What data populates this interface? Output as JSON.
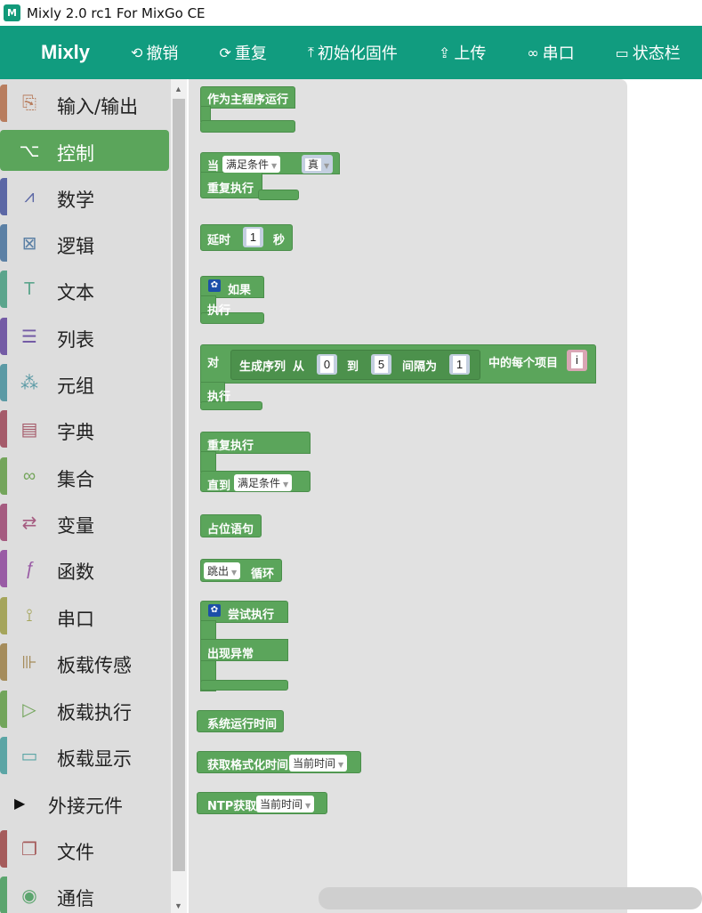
{
  "window": {
    "title": "Mixly 2.0 rc1 For MixGo CE",
    "icon_text": "M"
  },
  "toolbar": {
    "brand": "Mixly",
    "undo": "撤销",
    "redo": "重复",
    "init_firmware": "初始化固件",
    "upload": "上传",
    "serial": "串口",
    "statusbar": "状态栏"
  },
  "sidebar": {
    "items": [
      {
        "label": "输入/输出",
        "color": "#b87d5e"
      },
      {
        "label": "控制",
        "color": "#5ba55b"
      },
      {
        "label": "数学",
        "color": "#5b67a5"
      },
      {
        "label": "逻辑",
        "color": "#5b80a5"
      },
      {
        "label": "文本",
        "color": "#5ba58c"
      },
      {
        "label": "列表",
        "color": "#745ba5"
      },
      {
        "label": "元组",
        "color": "#5b9aa5"
      },
      {
        "label": "字典",
        "color": "#a55b6a"
      },
      {
        "label": "集合",
        "color": "#74a55b"
      },
      {
        "label": "变量",
        "color": "#a55b80"
      },
      {
        "label": "函数",
        "color": "#995ba5"
      },
      {
        "label": "串口",
        "color": "#a5a55b"
      },
      {
        "label": "板载传感",
        "color": "#a58c5b"
      },
      {
        "label": "板载执行",
        "color": "#72a55b"
      },
      {
        "label": "板载显示",
        "color": "#5ba5a5"
      },
      {
        "label": "外接元件"
      },
      {
        "label": "文件",
        "color": "#a55b5b"
      },
      {
        "label": "通信",
        "color": "#5ba56e"
      }
    ]
  },
  "blocks": {
    "main_program": "作为主程序运行",
    "while_when": "当",
    "while_cond": "满足条件",
    "while_true": "真",
    "while_do": "重复执行",
    "delay": "延时",
    "delay_value": "1",
    "delay_unit": "秒",
    "if": "如果",
    "if_do": "执行",
    "for_label": "对",
    "range_label": "生成序列",
    "range_from": "从",
    "range_from_val": "0",
    "range_to": "到",
    "range_to_val": "5",
    "range_step": "间隔为",
    "range_step_val": "1",
    "for_each": "中的每个项目",
    "for_var": "i",
    "for_do": "执行",
    "repeat": "重复执行",
    "until": "直到",
    "until_cond": "满足条件",
    "pass": "占位语句",
    "break_opt": "跳出",
    "break_loop": "循环",
    "try": "尝试执行",
    "except": "出现异常",
    "sys_time": "系统运行时间",
    "fmt_time": "获取格式化时间",
    "fmt_time_opt": "当前时间",
    "ntp": "NTP获取",
    "ntp_opt": "当前时间"
  }
}
